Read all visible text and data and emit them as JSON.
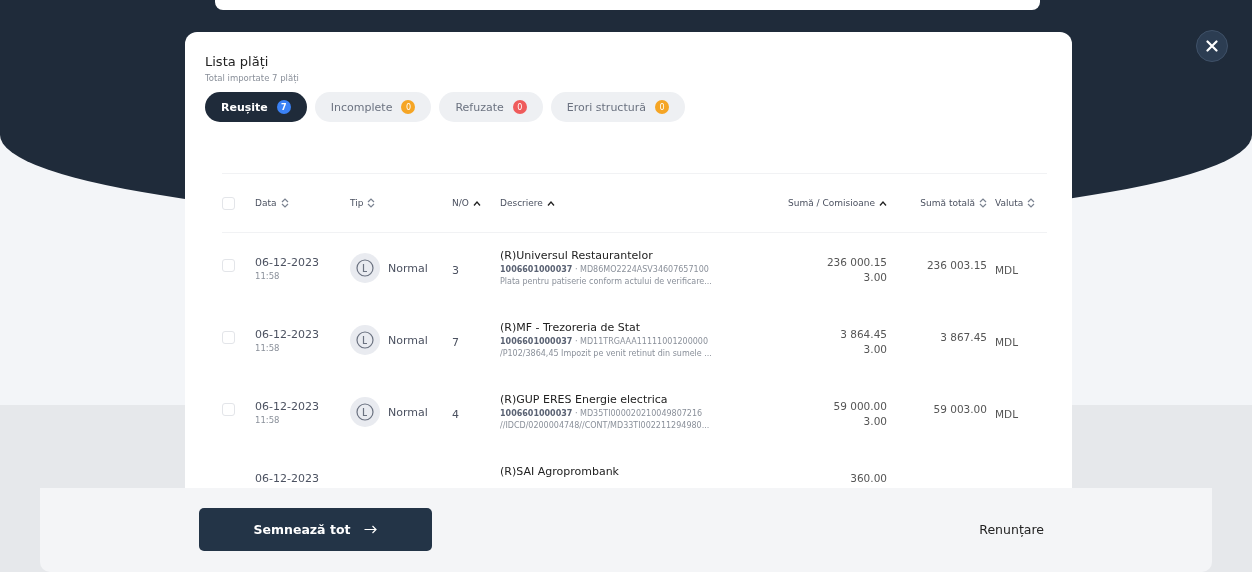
{
  "modal": {
    "title": "Lista plăți",
    "subtitle": "Total importate 7 plăți"
  },
  "tabs": [
    {
      "label": "Reușite",
      "count": "7",
      "color": "#3b82f6",
      "selected": true
    },
    {
      "label": "Incomplete",
      "count": "0",
      "color": "#f5a524",
      "selected": false
    },
    {
      "label": "Refuzate",
      "count": "0",
      "color": "#ef5b5b",
      "selected": false
    },
    {
      "label": "Erori structură",
      "count": "0",
      "color": "#f5a524",
      "selected": false
    }
  ],
  "table": {
    "select_all": {
      "checked": false
    },
    "columns": [
      {
        "label": "Data",
        "sorted": false
      },
      {
        "label": "Tip",
        "sorted": false
      },
      {
        "label": "N/O",
        "sorted": true
      },
      {
        "label": "Descriere",
        "sorted": true
      },
      {
        "label": "Sumă / Comisioane",
        "sorted": true
      },
      {
        "label": "Sumă totală",
        "sorted": false
      },
      {
        "label": "Valuta",
        "sorted": false
      }
    ],
    "rows": [
      {
        "checked": false,
        "date": "06-12-2023",
        "time": "11:58",
        "type": "Normal",
        "no": "3",
        "title": "(R)Universul Restaurantelor",
        "account": "**1006601000037** · MD86MO2224ASV34607657100",
        "details": "Plata pentru patiserie conform actului de verificare...",
        "amount": "236 000.15",
        "fee": "3.00",
        "total": "236 003.15",
        "currency": "MDL"
      },
      {
        "checked": false,
        "date": "06-12-2023",
        "time": "11:58",
        "type": "Normal",
        "no": "7",
        "title": "(R)MF - Trezoreria de Stat",
        "account": "**1006601000037** · MD11TRGAAA11111001200000",
        "details": "/P102/3864,45 Impozit pe venit retinut din sumele ...",
        "amount": "3 864.45",
        "fee": "3.00",
        "total": "3 867.45",
        "currency": "MDL"
      },
      {
        "checked": false,
        "date": "06-12-2023",
        "time": "11:58",
        "type": "Normal",
        "no": "4",
        "title": "(R)GUP ERES Energie electrica",
        "account": "**1006601000037** · MD35TI000020210049807216",
        "details": "//IDCD/0200004748//CONT/MD33TI002211294980...",
        "amount": "59 000.00",
        "fee": "3.00",
        "total": "59 003.00",
        "currency": "MDL"
      },
      {
        "date": "06-12-2023",
        "title": "(R)SAI Agroprombank",
        "amount": "360.00"
      }
    ]
  },
  "footer": {
    "primary": "Semnează tot",
    "secondary": "Renunțare"
  }
}
